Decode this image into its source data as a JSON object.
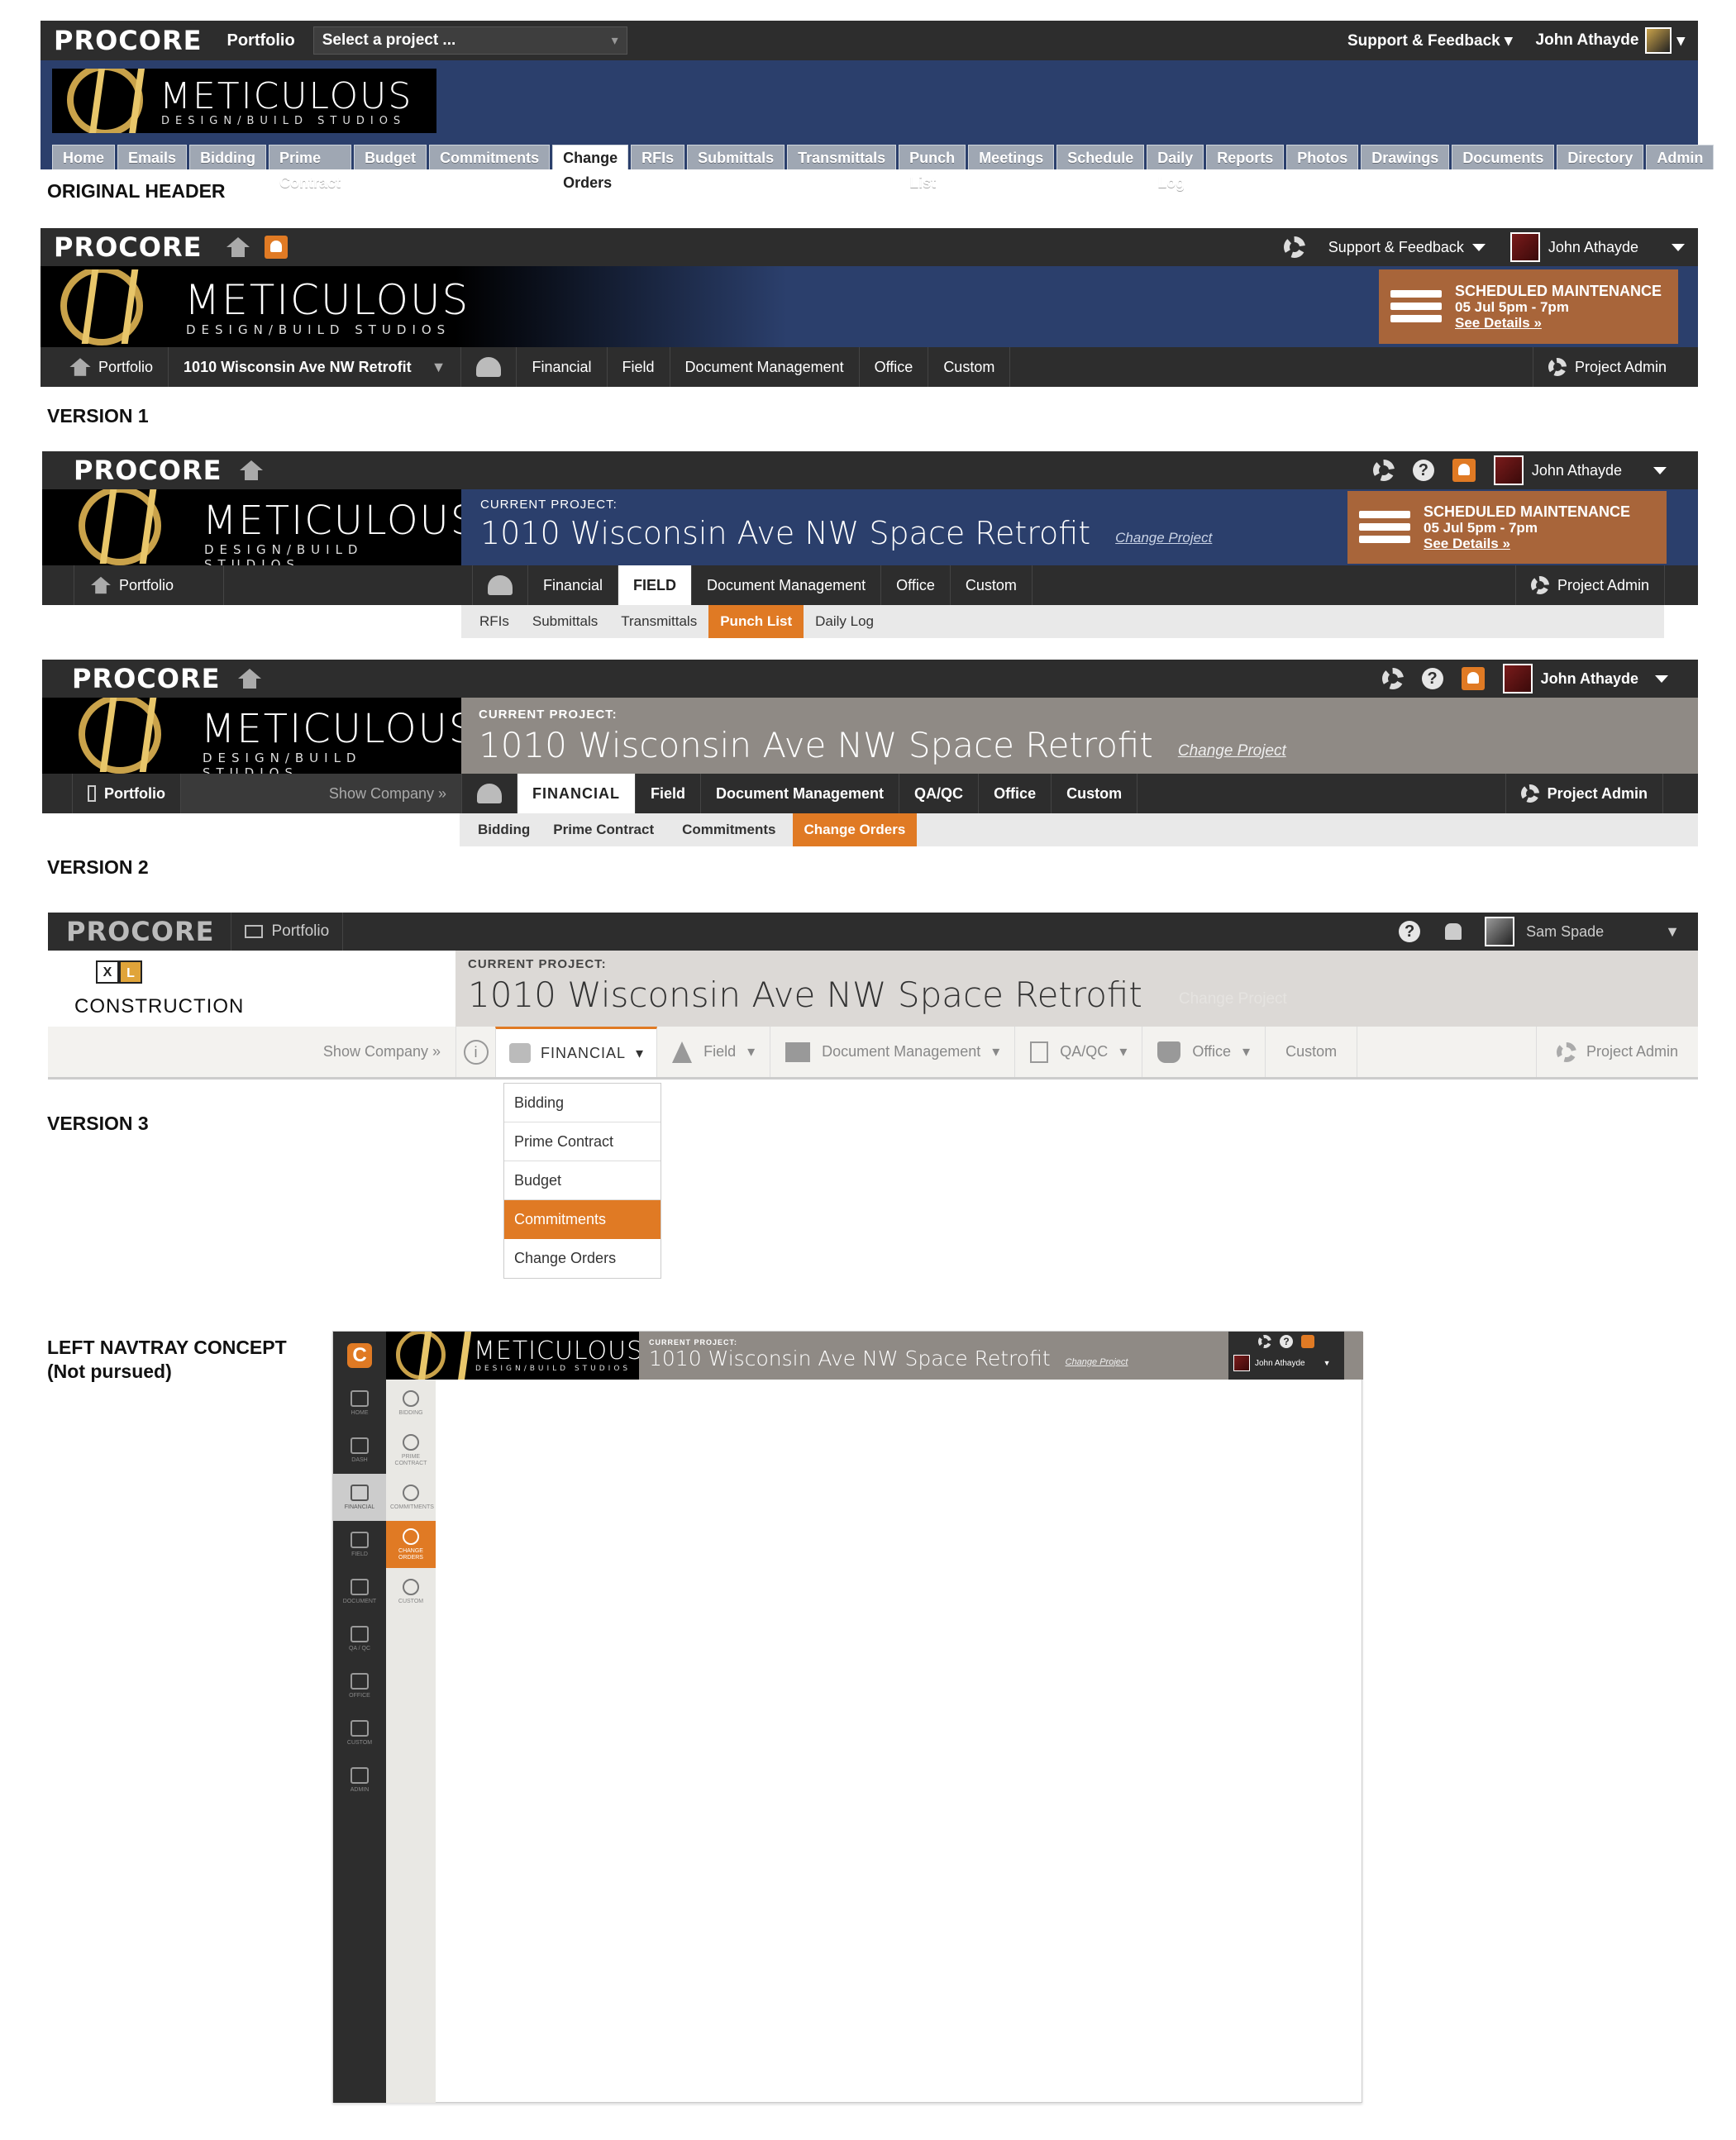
{
  "captions": {
    "original": "ORIGINAL HEADER",
    "v1": "VERSION 1",
    "v2": "VERSION 2",
    "v3": "VERSION 3",
    "left_line1": "LEFT NAVTRAY CONCEPT",
    "left_line2": "(Not pursued)"
  },
  "brand": {
    "procore": "PROCORE",
    "company": "METICULOUS",
    "company_sub": "DESIGN/BUILD STUDIOS"
  },
  "original": {
    "portfolio": "Portfolio",
    "select_project": "Select a project ...",
    "support": "Support & Feedback",
    "user": "John Athayde",
    "tabs": [
      "Home",
      "Emails",
      "Bidding",
      "Prime Contract",
      "Budget",
      "Commitments",
      "Change Orders",
      "RFIs",
      "Submittals",
      "Transmittals",
      "Punch List",
      "Meetings",
      "Schedule",
      "Daily Log",
      "Reports",
      "Photos",
      "Drawings",
      "Documents",
      "Directory",
      "Admin"
    ],
    "active_tab": "Change Orders"
  },
  "v1": {
    "support": "Support & Feedback",
    "user": "John Athayde",
    "maintenance_title": "SCHEDULED MAINTENANCE",
    "maintenance_time": "05 Jul  5pm - 7pm",
    "maintenance_link": "See Details »",
    "portfolio": "Portfolio",
    "project": "1010 Wisconsin Ave NW Retrofit",
    "nav": [
      "Financial",
      "Field",
      "Document Management",
      "Office",
      "Custom"
    ],
    "project_admin": "Project Admin"
  },
  "v2a": {
    "user": "John Athayde",
    "current_label": "CURRENT PROJECT:",
    "project": "1010 Wisconsin Ave NW Space Retrofit",
    "change": "Change Project",
    "maintenance_title": "SCHEDULED MAINTENANCE",
    "maintenance_time": "05 Jul  5pm - 7pm",
    "maintenance_link": "See Details »",
    "portfolio": "Portfolio",
    "nav": [
      "Financial",
      "FIELD",
      "Document Management",
      "Office",
      "Custom"
    ],
    "project_admin": "Project Admin",
    "sub": [
      "RFIs",
      "Submittals",
      "Transmittals",
      "Punch List",
      "Daily Log"
    ]
  },
  "v2b": {
    "user": "John Athayde",
    "current_label": "CURRENT PROJECT:",
    "project": "1010 Wisconsin Ave NW Space Retrofit",
    "change": "Change Project",
    "portfolio": "Portfolio",
    "show_company": "Show Company »",
    "nav": [
      "FINANCIAL",
      "Field",
      "Document Management",
      "QA/QC",
      "Office",
      "Custom"
    ],
    "project_admin": "Project Admin",
    "sub": [
      "Bidding",
      "Prime Contract",
      "Commitments",
      "Change Orders"
    ]
  },
  "v3": {
    "portfolio": "Portfolio",
    "user": "Sam Spade",
    "company_logo": "XL",
    "company_name": "CONSTRUCTION",
    "current_label": "CURRENT PROJECT:",
    "project": "1010 Wisconsin Ave NW Space Retrofit",
    "change": "Change Project",
    "show_company": "Show Company »",
    "nav": [
      "FINANCIAL",
      "Field",
      "Document Management",
      "QA/QC",
      "Office",
      "Custom"
    ],
    "project_admin": "Project Admin",
    "dropdown": [
      "Bidding",
      "Prime Contract",
      "Budget",
      "Commitments",
      "Change Orders"
    ]
  },
  "left": {
    "current_label": "CURRENT PROJECT:",
    "project": "1010 Wisconsin Ave NW Space Retrofit",
    "change": "Change Project",
    "user": "John Athayde",
    "tray1": [
      "HOME",
      "DASH",
      "FINANCIAL",
      "FIELD",
      "DOCUMENT",
      "QA / QC",
      "OFFICE",
      "CUSTOM",
      "ADMIN"
    ],
    "tray2": [
      "BIDDING",
      "PRIME CONTRACT",
      "COMMITMENTS",
      "CHANGE ORDERS",
      "CUSTOM"
    ]
  },
  "colors": {
    "accent": "#e07a24",
    "navy": "#2b3f6c",
    "dark": "#2d2d2d",
    "rust": "#a8653a"
  }
}
